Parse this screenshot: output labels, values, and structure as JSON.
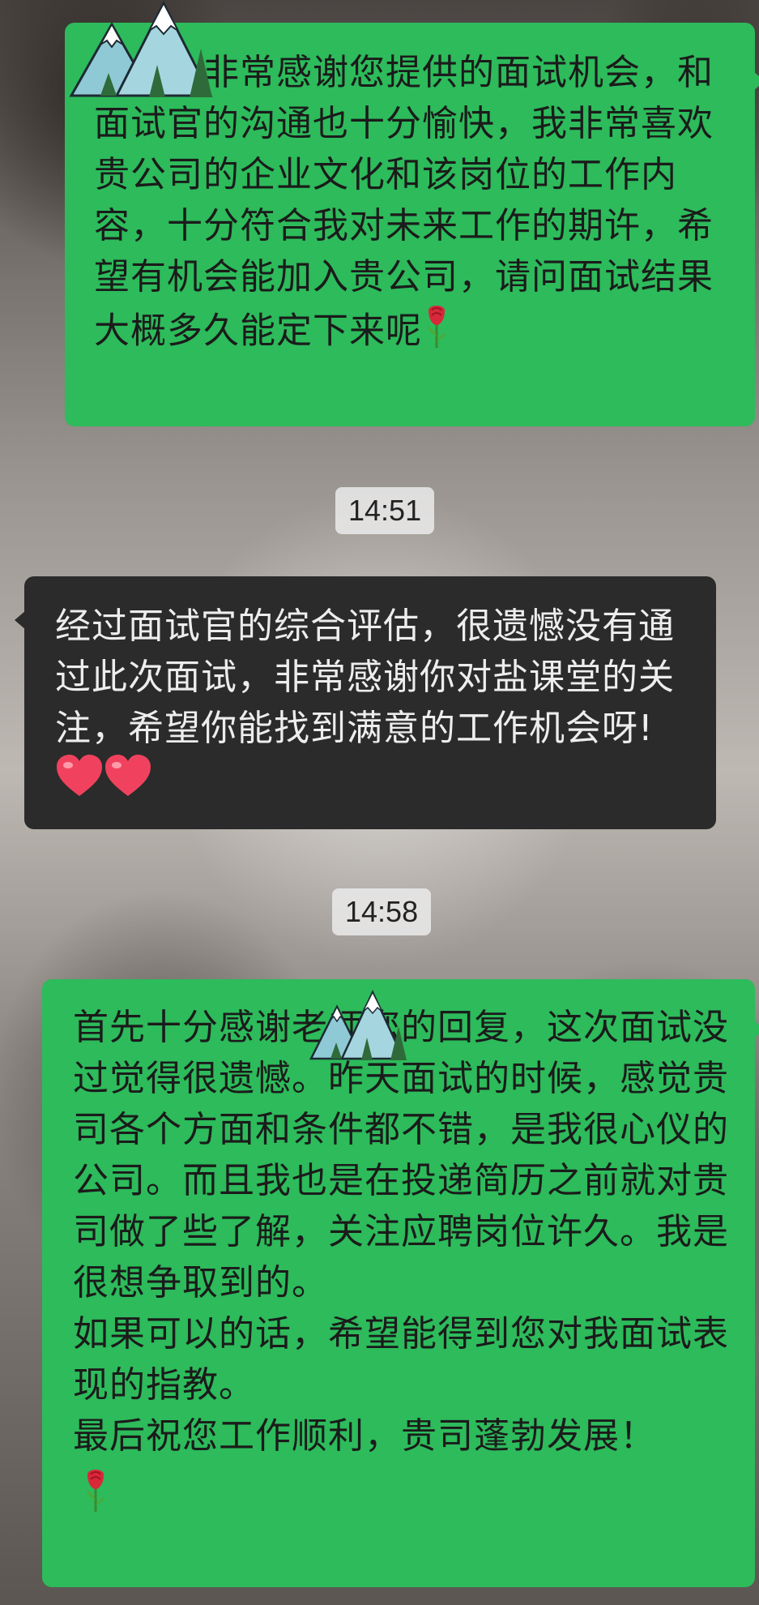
{
  "messages": [
    {
      "side": "right",
      "text": "您好，非常感谢您提供的面试机会，和面试官的沟通也十分愉快，我非常喜欢贵公司的企业文化和该岗位的工作内容，十分符合我对未来工作的期许，希望有机会能加入贵公司，请问面试结果大概多久能定下来呢",
      "emoji": "rose"
    },
    {
      "type": "timestamp",
      "text": "14:51"
    },
    {
      "side": "left",
      "text": "经过面试官的综合评估，很遗憾没有通过此次面试，非常感谢你对盐课堂的关注，希望你能找到满意的工作机会呀!",
      "emoji": "heart x2"
    },
    {
      "type": "timestamp",
      "text": "14:58"
    },
    {
      "side": "right",
      "text": "首先十分感谢老师您的回复，这次面试没过觉得很遗憾。昨天面试的时候，感觉贵司各个方面和条件都不错，是我很心仪的公司。而且我也是在投递简历之前就对贵司做了些了解，关注应聘岗位许久。我是很想争取到的。\n如果可以的话，希望能得到您对我面试表现的指教。\n最后祝您工作顺利，贵司蓬勃发展！",
      "emoji": "rose"
    }
  ],
  "colors": {
    "sent_bubble": "#2dbb5b",
    "received_bubble": "#2b2b2b",
    "timestamp_bg": "#ebebeb"
  },
  "icons": {
    "sticker": "mountain-sticker-icon",
    "rose": "rose-icon",
    "heart": "heart-icon"
  }
}
